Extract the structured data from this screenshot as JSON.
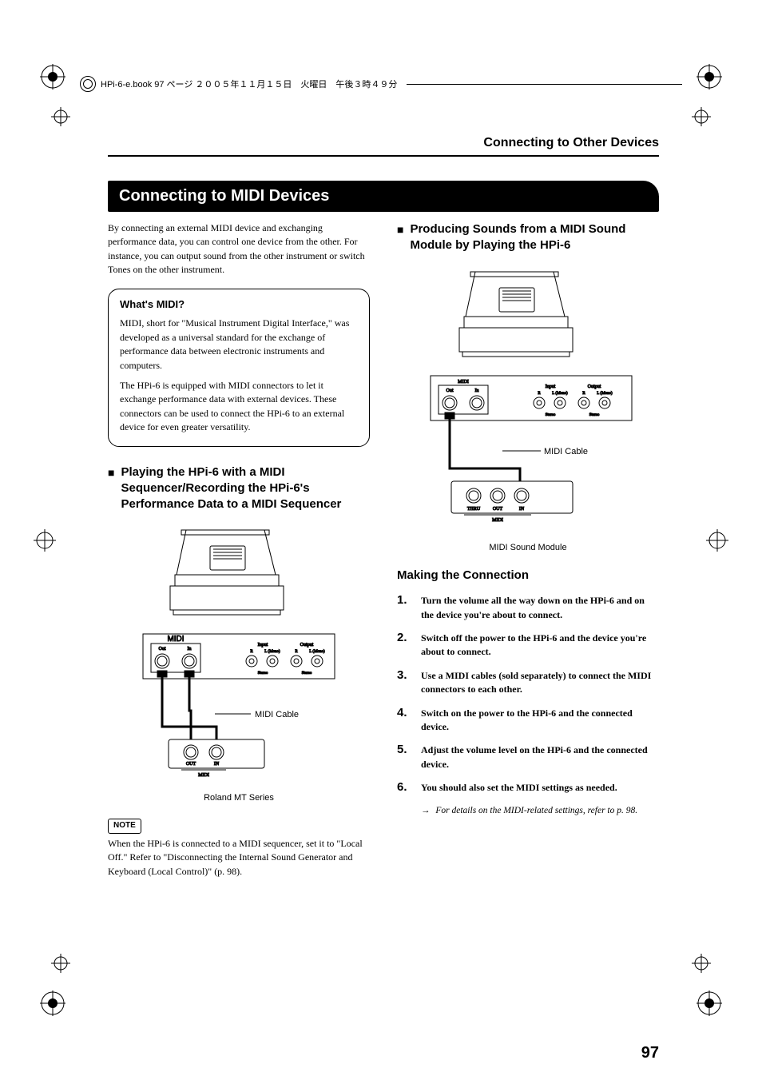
{
  "header": {
    "book_info": "HPi-6-e.book  97 ページ  ２００５年１１月１５日　火曜日　午後３時４９分"
  },
  "running_head": "Connecting to Other Devices",
  "title": "Connecting to MIDI Devices",
  "intro": "By connecting an external MIDI device and exchanging performance data, you can control one device from the other. For instance, you can output sound from the other instrument or switch Tones on the other instrument.",
  "callout": {
    "title": "What's MIDI?",
    "p1": "MIDI, short for \"Musical Instrument Digital Interface,\" was developed as a universal standard for the exchange of performance data between electronic instruments and computers.",
    "p2": "The HPi-6 is equipped with MIDI connectors to let it exchange performance data with external devices. These connectors can be used to connect the HPi-6 to an external device for even greater versatility."
  },
  "left_subhead": "Playing the HPi-6 with a MIDI Sequencer/Recording the HPi-6's Performance Data to a MIDI Sequencer",
  "diagram_left": {
    "midi_label": "MIDI",
    "out": "Out",
    "in": "In",
    "input": "Input",
    "output": "Output",
    "r": "R",
    "l": "L (Mono)",
    "stereo": "Stereo",
    "cable": "MIDI Cable",
    "out2": "OUT",
    "in2": "IN",
    "midi2": "MIDI",
    "caption": "Roland MT Series"
  },
  "note": {
    "badge": "NOTE",
    "text": "When the HPi-6 is connected to a MIDI sequencer, set it to \"Local Off.\" Refer to \"Disconnecting the Internal Sound Generator and Keyboard (Local Control)\" (p. 98)."
  },
  "right_subhead": "Producing Sounds from a MIDI Sound Module by Playing the HPi-6",
  "diagram_right": {
    "cable": "MIDI Cable",
    "thru": "THRU",
    "out": "OUT",
    "in": "IN",
    "midi": "MIDI",
    "caption": "MIDI Sound Module"
  },
  "making_connection": {
    "title": "Making the Connection",
    "steps": [
      "Turn the volume all the way down on the HPi-6 and on the device you're about to connect.",
      "Switch off the power to the HPi-6 and the device you're about to connect.",
      "Use a MIDI cables (sold separately) to connect the MIDI connectors to each other.",
      "Switch on the power to the HPi-6 and the connected device.",
      "Adjust the volume level on the HPi-6 and the connected device.",
      "You should also set the MIDI settings as needed."
    ],
    "sub": "For details on the MIDI-related settings, refer to p. 98."
  },
  "page_number": "97"
}
